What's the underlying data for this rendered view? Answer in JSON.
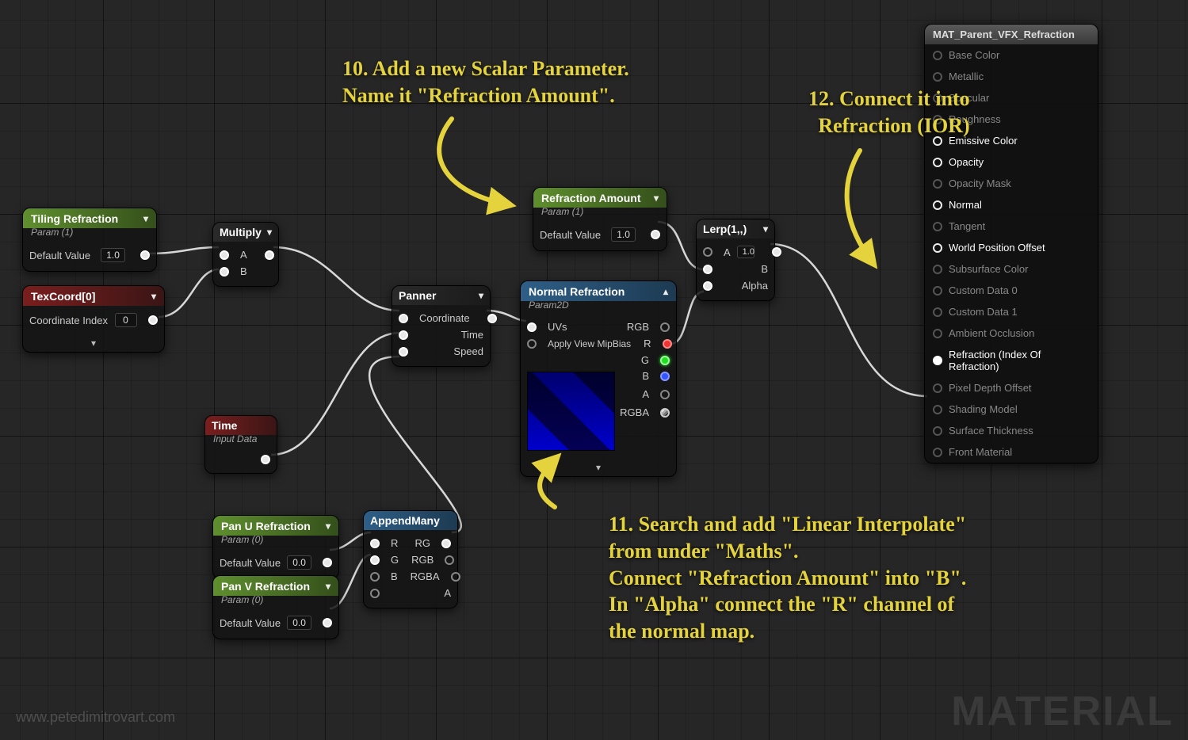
{
  "annotations": {
    "a10": "10. Add a new Scalar Parameter.\nName it \"Refraction Amount\".",
    "a11": "11. Search and add \"Linear Interpolate\"\nfrom under \"Maths\".\nConnect \"Refraction Amount\" into \"B\".\nIn \"Alpha\" connect the \"R\" channel of\nthe normal map.",
    "a12": "12. Connect it into\nRefraction (IOR)"
  },
  "watermark_big": "MATERIAL",
  "watermark_url": "www.petedimitrovart.com",
  "nodes": {
    "tiling": {
      "title": "Tiling Refraction",
      "subtitle": "Param (1)",
      "label_default": "Default Value",
      "value": "1.0"
    },
    "texcoord": {
      "title": "TexCoord[0]",
      "label_idx": "Coordinate Index",
      "value": "0"
    },
    "multiply": {
      "title": "Multiply",
      "a": "A",
      "b": "B"
    },
    "panner": {
      "title": "Panner",
      "coord": "Coordinate",
      "time": "Time",
      "speed": "Speed"
    },
    "time": {
      "title": "Time",
      "subtitle": "Input Data"
    },
    "panu": {
      "title": "Pan U Refraction",
      "subtitle": "Param (0)",
      "label_default": "Default Value",
      "value": "0.0"
    },
    "panv": {
      "title": "Pan V Refraction",
      "subtitle": "Param (0)",
      "label_default": "Default Value",
      "value": "0.0"
    },
    "appendmany": {
      "title": "AppendMany",
      "r": "R",
      "g": "G",
      "b": "B",
      "a": "A",
      "rg": "RG",
      "rgb": "RGB",
      "rgba": "RGBA"
    },
    "refraction_amount": {
      "title": "Refraction Amount",
      "subtitle": "Param (1)",
      "label_default": "Default Value",
      "value": "1.0"
    },
    "normal_refraction": {
      "title": "Normal Refraction",
      "subtitle": "Param2D",
      "uvs": "UVs",
      "mip": "Apply View MipBias",
      "rgb": "RGB",
      "r": "R",
      "g": "G",
      "b": "B",
      "a": "A",
      "rgba": "RGBA"
    },
    "lerp": {
      "title": "Lerp(1,,)",
      "a": "A",
      "b": "B",
      "alpha": "Alpha",
      "a_val": "1.0"
    }
  },
  "mat_panel": {
    "title": "MAT_Parent_VFX_Refraction",
    "pins": [
      {
        "label": "Base Color",
        "active": false
      },
      {
        "label": "Metallic",
        "active": false
      },
      {
        "label": "Specular",
        "active": false
      },
      {
        "label": "Roughness",
        "active": false
      },
      {
        "label": "Emissive Color",
        "active": true
      },
      {
        "label": "Opacity",
        "active": true
      },
      {
        "label": "Opacity Mask",
        "active": false
      },
      {
        "label": "Normal",
        "active": true
      },
      {
        "label": "Tangent",
        "active": false
      },
      {
        "label": "World Position Offset",
        "active": true
      },
      {
        "label": "Subsurface Color",
        "active": false
      },
      {
        "label": "Custom Data 0",
        "active": false
      },
      {
        "label": "Custom Data 1",
        "active": false
      },
      {
        "label": "Ambient Occlusion",
        "active": false
      },
      {
        "label": "Refraction (Index Of Refraction)",
        "active": true,
        "connected": true
      },
      {
        "label": "Pixel Depth Offset",
        "active": false
      },
      {
        "label": "Shading Model",
        "active": false
      },
      {
        "label": "Surface Thickness",
        "active": false
      },
      {
        "label": "Front Material",
        "active": false
      }
    ]
  }
}
